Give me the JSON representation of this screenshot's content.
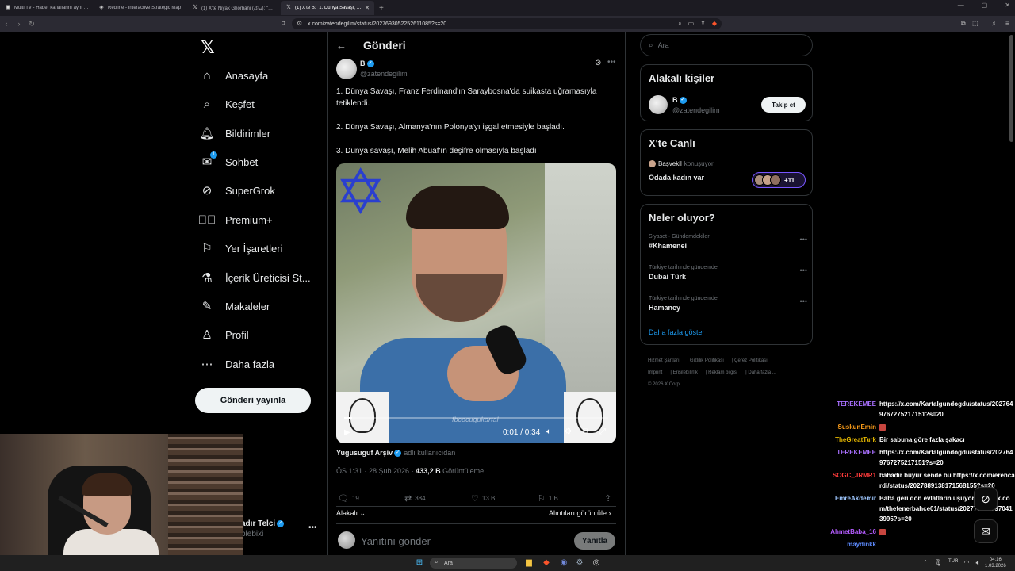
{
  "browser": {
    "tabs": [
      {
        "title": "Multi TV - Haber kanallarını aynı anda izle",
        "icon": "tv-icon",
        "active": false
      },
      {
        "title": "Redline - Interactive Strategic Map",
        "icon": "map-icon",
        "active": false
      },
      {
        "title": "(1) X'te Niyak Ghorbani (نیاک): \"Gelo",
        "icon": "x-icon",
        "active": false
      },
      {
        "title": "(1) X'te B: \"1. Dünya Savaşı, Franz",
        "icon": "x-icon",
        "active": true
      }
    ],
    "url": "x.com/zatendegilim/status/2027693052252611085?s=20"
  },
  "sidebar": {
    "items": [
      {
        "label": "Anasayfa",
        "icon": "home-icon"
      },
      {
        "label": "Keşfet",
        "icon": "search-icon"
      },
      {
        "label": "Bildirimler",
        "icon": "bell-icon"
      },
      {
        "label": "Sohbet",
        "icon": "mail-icon",
        "badge": "1"
      },
      {
        "label": "SuperGrok",
        "icon": "grok-icon"
      },
      {
        "label": "Premium+",
        "icon": "premium-icon"
      },
      {
        "label": "Yer İşaretleri",
        "icon": "bookmark-icon"
      },
      {
        "label": "İçerik Üreticisi St...",
        "icon": "creator-studio-icon"
      },
      {
        "label": "Makaleler",
        "icon": "article-icon"
      },
      {
        "label": "Profil",
        "icon": "profile-icon"
      },
      {
        "label": "Daha fazla",
        "icon": "more-circle-icon"
      }
    ],
    "post_button": "Gönderi yayınla",
    "account": {
      "name": "adır Telci",
      "handle": "plebixi"
    }
  },
  "header": {
    "title": "Gönderi"
  },
  "tweet": {
    "author_name": "B",
    "author_handle": "@zatendegilim",
    "lines": [
      "1. Dünya Savaşı, Franz Ferdinand'ın Saraybosna'da suikasta uğramasıyla tetiklendi.",
      "2. Dünya Savaşı, Almanya'nın Polonya'yı işgal etmesiyle başladı.",
      "3. Dünya savaşı, Melih Abuaf'ın deşifre olmasıyla başladı"
    ],
    "video": {
      "current": "0:01",
      "duration": "0:34",
      "time_display": "0:01 / 0:34",
      "progress": 0.03,
      "watermark": "fbcocugukartal"
    },
    "video_source_name": "Yugusuguf Arşiv",
    "video_source_suffix": "adlı kullanıcıdan",
    "time": "ÖS 1:31 · 28 Şub 2026 · ",
    "views": "433,2 B",
    "views_label": " Görüntüleme",
    "stats": {
      "replies": "19",
      "reposts": "384",
      "likes": "13 B",
      "bookmarks": "1 B"
    },
    "sort_label": "Alakalı",
    "quotes_label": "Alıntıları görüntüle",
    "reply_placeholder": "Yanıtını gönder",
    "reply_button": "Yanıtla"
  },
  "right": {
    "search_placeholder": "Ara",
    "related": {
      "title": "Alakalı kişiler",
      "name": "B",
      "handle": "@zatendegilim",
      "follow": "Takip et"
    },
    "live": {
      "title": "X'te Canlı",
      "host": "Başvekil",
      "speaking": "konuşuyor",
      "room": "Odada kadın var",
      "more_count": "+11"
    },
    "trends": {
      "title": "Neler oluyor?",
      "items": [
        {
          "context": "Siyaset · Gündemdekiler",
          "title": "#Khamenei"
        },
        {
          "context": "Türkiye tarihinde gündemde",
          "title": "Dubai Türk"
        },
        {
          "context": "Türkiye tarihinde gündemde",
          "title": "Hamaney"
        }
      ],
      "show_more": "Daha fazla göster"
    },
    "footer": [
      "Hizmet Şartları",
      "Gizlilik Politikası",
      "Çerez Politikası",
      "Imprint",
      "Erişilebilirlik",
      "Reklam bilgisi",
      "Daha fazla ...",
      "© 2026 X Corp."
    ]
  },
  "chat": [
    {
      "user": "TEREKEMEE",
      "color": "#a970ff",
      "msg": "https://x.com/Kartalgundogdu/status/2027649767275217151?s=20"
    },
    {
      "user": "SuskunEmin",
      "color": "#ff9f1a",
      "msg": "",
      "emote": true
    },
    {
      "user": "TheGreatTurk",
      "color": "#e6b800",
      "msg": "Bir sabuna göre fazla şakacı"
    },
    {
      "user": "TEREKEMEE",
      "color": "#a970ff",
      "msg": "https://x.com/Kartalgundogdu/status/2027649767275217151?s=20"
    },
    {
      "user": "SOGC_JRMR1",
      "color": "#ff3b3b",
      "msg": "bahadır buyur sende bu https://x.com/erencardi/status/2027889138171568155?s=20"
    },
    {
      "user": "EmreAkdemir",
      "color": "#9ec7ff",
      "msg": "Baba geri dön evlatların üşüyor https://x.com/thefenerbahce01/status/2027700697970413995?s=20"
    },
    {
      "user": "AhmetBaba_16",
      "color": "#b45cff",
      "msg": "",
      "emote": true
    },
    {
      "user": "maydinkk",
      "color": "#5d8bff",
      "msg": ""
    }
  ],
  "taskbar": {
    "search": "Ara",
    "lang": "TUR",
    "time": "04:16",
    "date": "1.03.2026"
  }
}
